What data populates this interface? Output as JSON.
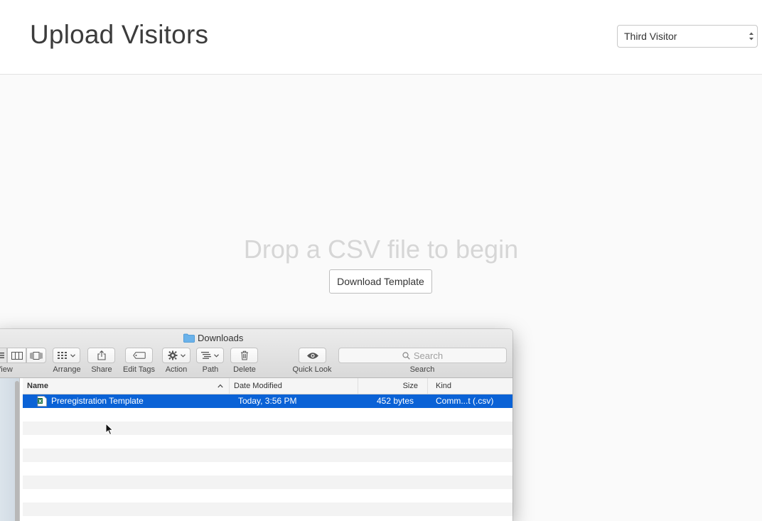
{
  "header": {
    "title": "Upload Visitors",
    "visitor_select": {
      "value": "Third Visitor"
    }
  },
  "dropzone": {
    "message": "Drop a CSV file to begin",
    "download_button": "Download Template"
  },
  "finder": {
    "window_title": "Downloads",
    "toolbar": {
      "view_label": "View",
      "arrange_label": "Arrange",
      "share_label": "Share",
      "edit_tags_label": "Edit Tags",
      "action_label": "Action",
      "path_label": "Path",
      "delete_label": "Delete",
      "quick_look_label": "Quick Look",
      "search_label": "Search",
      "search_placeholder": "Search"
    },
    "columns": {
      "name": "Name",
      "date_modified": "Date Modified",
      "size": "Size",
      "kind": "Kind"
    },
    "files": [
      {
        "name": "Preregistration Template",
        "date_modified": "Today, 3:56 PM",
        "size": "452 bytes",
        "kind": "Comm...t (.csv)"
      }
    ]
  },
  "colors": {
    "selection": "#0a62d6",
    "title_text": "#3c3c3c",
    "dropzone_text": "#d6d6d6"
  },
  "icons": {
    "view_list": "list-view-icon",
    "view_columns": "column-view-icon",
    "view_coverflow": "cover-flow-icon",
    "arrange": "grid-arrange-icon",
    "share": "share-icon",
    "edit_tags": "tag-icon",
    "action": "gear-icon",
    "path": "path-icon",
    "delete": "trash-icon",
    "quick_look": "eye-icon",
    "search": "magnifier-icon",
    "file": "excel-file-icon",
    "folder": "folder-icon"
  }
}
